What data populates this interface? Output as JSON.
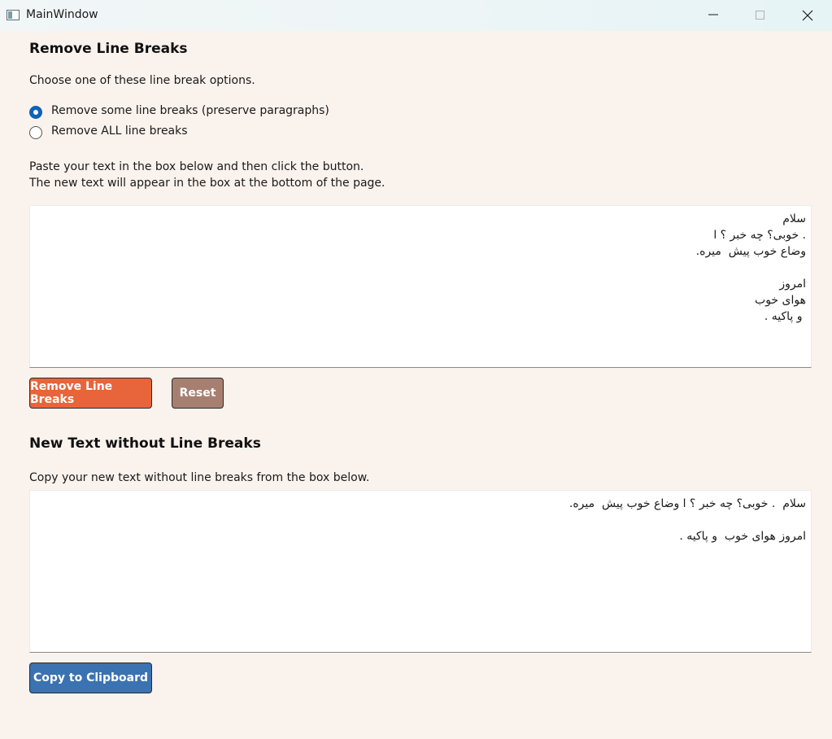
{
  "window": {
    "title": "MainWindow",
    "controls": [
      "minimize-icon",
      "maximize-icon",
      "close-icon"
    ]
  },
  "section1": {
    "heading": "Remove Line Breaks",
    "instruction": "Choose one of these line break options.",
    "options": [
      {
        "label": "Remove some line breaks (preserve paragraphs)",
        "selected": true
      },
      {
        "label": "Remove ALL line breaks",
        "selected": false
      }
    ],
    "paste_line1": "Paste your text in the box below and then click the button.",
    "paste_line2": "The new text will appear in the box at the bottom of the page.",
    "input_lines": [
      "سلام",
      ". خوبی؟ چه خبر ؟ ا",
      "وضاع خوب پیش  میره.",
      "",
      "امروز",
      "هوای خوب",
      " و پاکیه ."
    ]
  },
  "buttons": {
    "remove_label": "Remove Line Breaks",
    "reset_label": "Reset",
    "copy_label": "Copy to Clipboard"
  },
  "section2": {
    "heading": "New Text without Line Breaks",
    "instruction": "Copy your new text without line breaks from the box below.",
    "output_lines": [
      "سلام  . خوبی؟ چه خبر ؟ ا وضاع خوب پیش  میره.",
      "",
      "امروز هوای خوب  و پاکیه ."
    ]
  },
  "colors": {
    "background": "#faf2ed",
    "remove_button": "#e8643a",
    "reset_button": "#a77f70",
    "copy_button": "#3b72b1",
    "radio_accent": "#0f62b6"
  }
}
